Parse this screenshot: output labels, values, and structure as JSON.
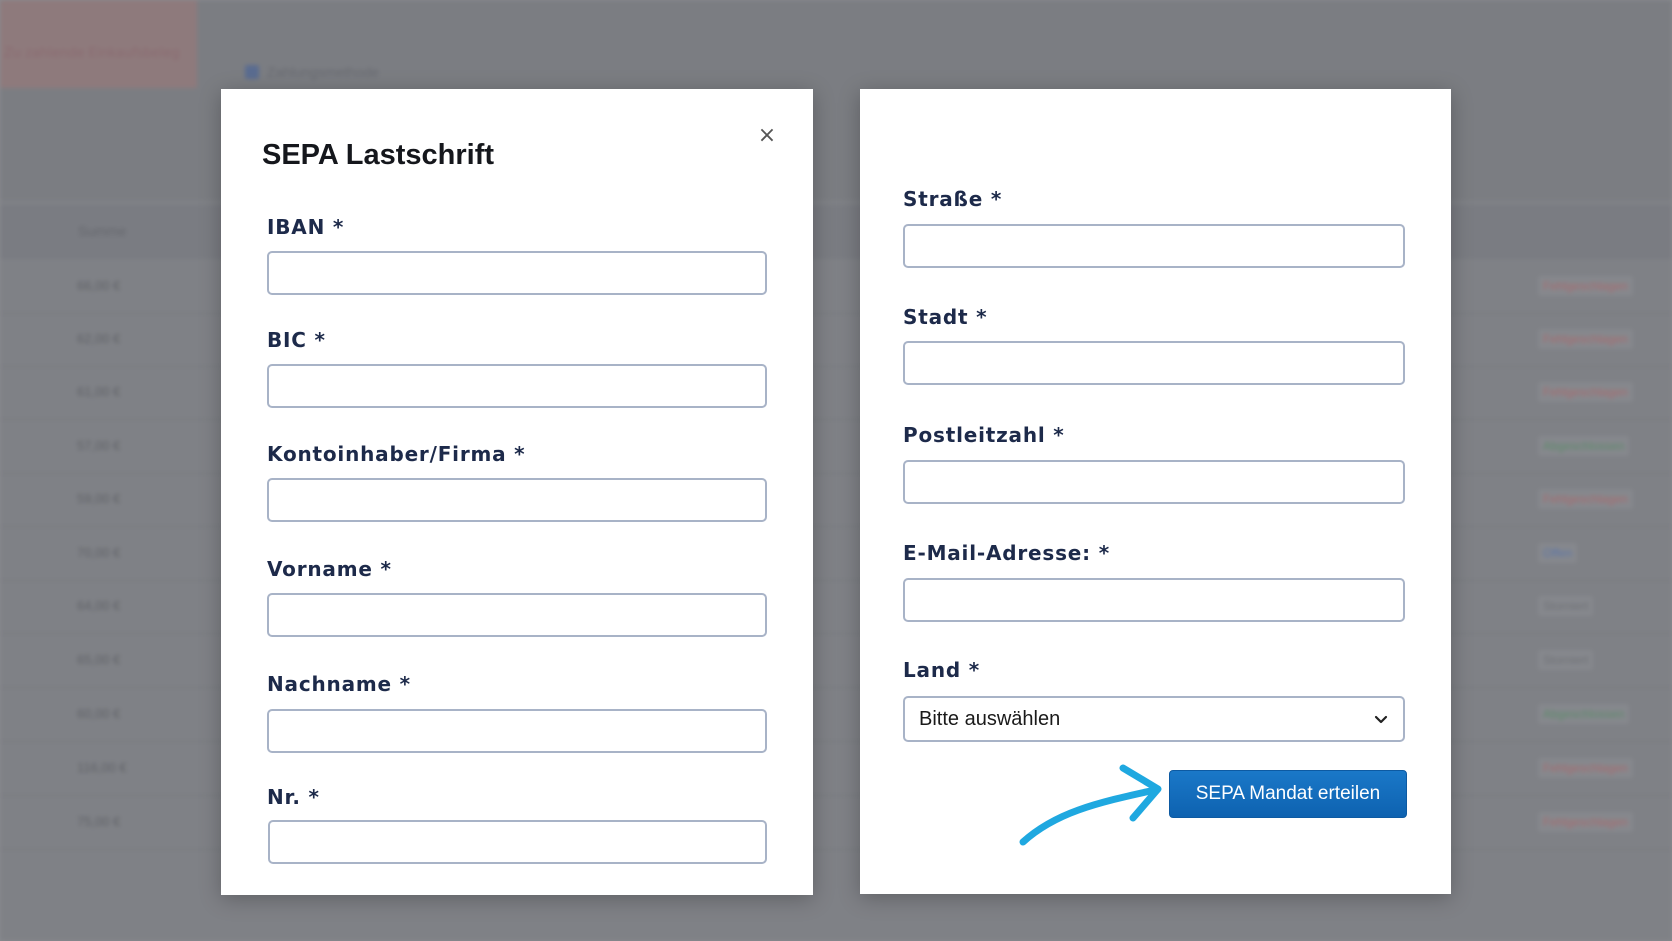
{
  "background": {
    "top_left_text": "Zu zahlende Einkaufsbeleg",
    "payment_method": "Zahlungsmethode",
    "column_header": "Summe",
    "rows": [
      {
        "sum": "66,00 €",
        "status": "Fehlgeschlagen",
        "status_color": "#a86a6e"
      },
      {
        "sum": "62,00 €",
        "status": "Fehlgeschlagen",
        "status_color": "#a86a6e"
      },
      {
        "sum": "61,00 €",
        "status": "Fehlgeschlagen",
        "status_color": "#a86a6e"
      },
      {
        "sum": "57,00 €",
        "status": "Abgeschlossen",
        "status_color": "#5c8a6a"
      },
      {
        "sum": "59,00 €",
        "status": "Fehlgeschlagen",
        "status_color": "#a86a6e"
      },
      {
        "sum": "70,00 €",
        "status": "Offen",
        "status_color": "#5a74a8"
      },
      {
        "sum": "64,00 €",
        "status": "Storniert",
        "status_color": "#6e7075"
      },
      {
        "sum": "65,00 €",
        "status": "Storniert",
        "status_color": "#6e7075"
      },
      {
        "sum": "60,00 €",
        "status": "Abgeschlossen",
        "status_color": "#5c8a6a"
      },
      {
        "sum": "116,00 €",
        "status": "Fehlgeschlagen",
        "status_color": "#a86a6e"
      },
      {
        "sum": "75,00 €",
        "status": "Fehlgeschlagen",
        "status_color": "#a86a6e"
      }
    ]
  },
  "modal_left": {
    "title": "SEPA Lastschrift",
    "close_icon": "×",
    "fields": {
      "iban": {
        "label": "IBAN *",
        "value": ""
      },
      "bic": {
        "label": "BIC *",
        "value": ""
      },
      "kontoinhaber": {
        "label": "Kontoinhaber/Firma *",
        "value": ""
      },
      "vorname": {
        "label": "Vorname *",
        "value": ""
      },
      "nachname": {
        "label": "Nachname *",
        "value": ""
      },
      "nr": {
        "label": "Nr. *",
        "value": ""
      }
    }
  },
  "modal_right": {
    "fields": {
      "strasse": {
        "label": "Straße *",
        "value": ""
      },
      "stadt": {
        "label": "Stadt *",
        "value": ""
      },
      "postleitzahl": {
        "label": "Postleitzahl *",
        "value": ""
      },
      "email": {
        "label": "E-Mail-Adresse: *",
        "value": ""
      }
    },
    "land": {
      "label": "Land *",
      "selected": "Bitte auswählen",
      "icon": "chevron-down-icon"
    },
    "submit_label": "SEPA Mandat erteilen",
    "accent_color": "#1a6fc0",
    "arrow_color": "#1fa8e0"
  }
}
